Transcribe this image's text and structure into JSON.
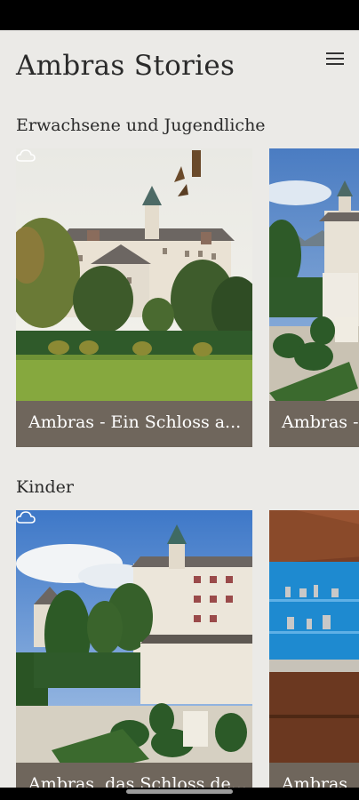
{
  "app": {
    "title": "Ambras Stories",
    "menu_icon": "hamburger-menu-icon"
  },
  "sections": [
    {
      "title": "Erwachsene und Jugendliche",
      "cards": [
        {
          "label": "Ambras - Ein Schloss a...",
          "cloud_icon": true
        },
        {
          "label": "Ambras - ",
          "cloud_icon": false
        }
      ]
    },
    {
      "title": "Kinder",
      "cards": [
        {
          "label": "Ambras, das Schloss de...",
          "cloud_icon": true
        },
        {
          "label": "Ambras",
          "cloud_icon": false
        }
      ]
    }
  ],
  "colors": {
    "background": "#ebeae7",
    "caption_bar": "#6f665c",
    "text": "#2a2a2a"
  }
}
